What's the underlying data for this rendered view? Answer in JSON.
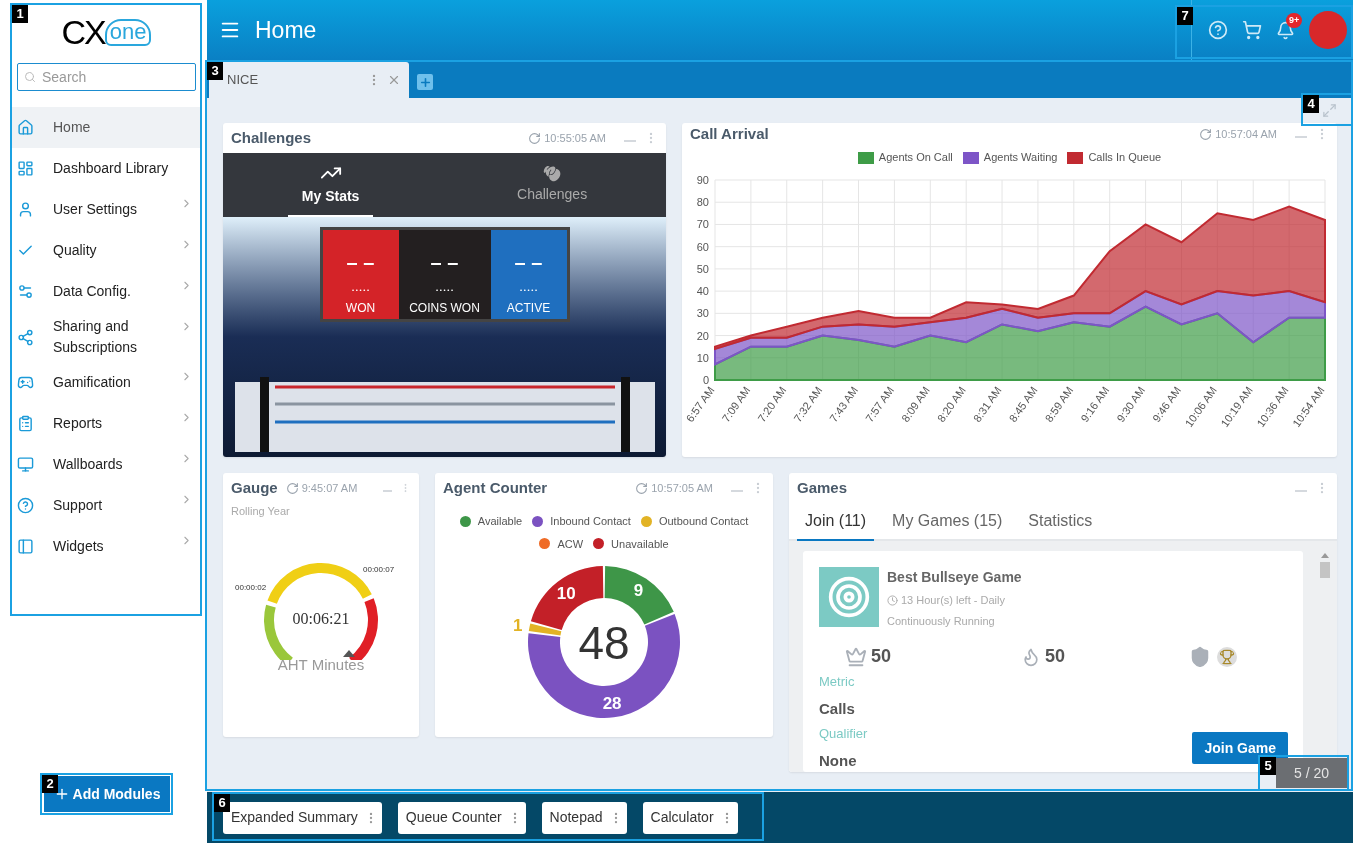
{
  "callouts": [
    "1",
    "2",
    "3",
    "4",
    "5",
    "6",
    "7"
  ],
  "sidebar": {
    "logo": {
      "main": "CX",
      "sub": "one"
    },
    "search": {
      "placeholder": "Search"
    },
    "items": [
      {
        "label": "Home",
        "selected": true,
        "expandable": false
      },
      {
        "label": "Dashboard Library",
        "selected": false,
        "expandable": false
      },
      {
        "label": "User Settings",
        "selected": false,
        "expandable": true
      },
      {
        "label": "Quality",
        "selected": false,
        "expandable": true
      },
      {
        "label": "Data Config.",
        "selected": false,
        "expandable": true
      },
      {
        "label": "Sharing and Subscriptions",
        "selected": false,
        "expandable": true
      },
      {
        "label": "Gamification",
        "selected": false,
        "expandable": true
      },
      {
        "label": "Reports",
        "selected": false,
        "expandable": true
      },
      {
        "label": "Wallboards",
        "selected": false,
        "expandable": true
      },
      {
        "label": "Support",
        "selected": false,
        "expandable": true
      },
      {
        "label": "Widgets",
        "selected": false,
        "expandable": true
      }
    ],
    "add_button": "Add Modules"
  },
  "header": {
    "title": "Home",
    "notification_badge": "9+"
  },
  "tabs": [
    {
      "label": "NICE",
      "selected": true
    }
  ],
  "challenges": {
    "title": "Challenges",
    "time": "10:55:05 AM",
    "tabs": [
      {
        "label": "My Stats",
        "selected": true
      },
      {
        "label": "Challenges",
        "selected": false
      }
    ],
    "scoreboard": [
      {
        "value": "– –",
        "dots": "• • • • •",
        "label": "WON",
        "color": "#d42328"
      },
      {
        "value": "– –",
        "dots": "• • • • •",
        "label": "COINS WON",
        "color": "#231f20"
      },
      {
        "value": "– –",
        "dots": "• • • • •",
        "label": "ACTIVE",
        "color": "#1f6fbf"
      }
    ]
  },
  "call_arrival": {
    "title": "Call Arrival",
    "time": "10:57:04 AM",
    "chart_data": {
      "type": "area",
      "stacked": true,
      "grid": true,
      "legend": "top",
      "categories": [
        "6:57 AM",
        "7:09 AM",
        "7:20 AM",
        "7:32 AM",
        "7:43 AM",
        "7:57 AM",
        "8:09 AM",
        "8:20 AM",
        "8:31 AM",
        "8:45 AM",
        "8:59 AM",
        "9:16 AM",
        "9:30 AM",
        "9:46 AM",
        "10:06 AM",
        "10:19 AM",
        "10:36 AM",
        "10:54 AM"
      ],
      "ylim": [
        0,
        90
      ],
      "yticks": [
        0,
        10,
        20,
        30,
        40,
        50,
        60,
        70,
        80,
        90
      ],
      "series": [
        {
          "name": "Agents On Call",
          "color": "#3e9c47",
          "values": [
            7,
            15,
            15,
            20,
            18,
            15,
            20,
            17,
            25,
            22,
            26,
            24,
            33,
            25,
            30,
            17,
            28,
            28
          ]
        },
        {
          "name": "Agents Waiting",
          "color": "#7d55c7",
          "values": [
            7,
            4,
            4,
            4,
            7,
            9,
            6,
            11,
            7,
            6,
            4,
            6,
            7,
            9,
            10,
            21,
            12,
            7
          ]
        },
        {
          "name": "Calls In Queue",
          "color": "#c12a31",
          "values": [
            1,
            1,
            5,
            4,
            6,
            4,
            2,
            7,
            2,
            4,
            8,
            28,
            30,
            28,
            35,
            34,
            38,
            37
          ]
        }
      ]
    }
  },
  "gauge": {
    "title": "Gauge",
    "time": "9:45:07 AM",
    "subtitle": "Rolling Year",
    "low_label": "00:00:02",
    "high_label": "00:00:07",
    "value": "00:06:21",
    "caption": "AHT Minutes"
  },
  "agent_counter": {
    "title": "Agent Counter",
    "time": "10:57:05 AM",
    "total": "48",
    "chart_data": {
      "type": "donut",
      "data_labels": true,
      "values": [
        9,
        28,
        1,
        0,
        10
      ]
    },
    "legend": [
      {
        "label": "Available",
        "color": "#3e9648"
      },
      {
        "label": "Inbound Contact",
        "color": "#7b52c1"
      },
      {
        "label": "Outbound Contact",
        "color": "#e2b325"
      },
      {
        "label": "ACW",
        "color": "#ef6b26"
      },
      {
        "label": "Unavailable",
        "color": "#c32028"
      }
    ]
  },
  "games": {
    "title": "Games",
    "tabs": [
      {
        "label": "Join (11)",
        "selected": true
      },
      {
        "label": "My Games (15)",
        "selected": false
      },
      {
        "label": "Statistics",
        "selected": false
      }
    ],
    "game": {
      "name": "Best Bullseye Game",
      "time_left": "13 Hour(s) left - Daily",
      "status": "Continuously Running",
      "crowns": "50",
      "flames": "50",
      "metric_label": "Metric",
      "metric": "Calls",
      "qualifier_label": "Qualifier",
      "qualifier": "None",
      "button": "Join Game"
    }
  },
  "pager": "5 / 20",
  "tray": [
    "Expanded Summary",
    "Queue Counter",
    "Notepad",
    "Calculator"
  ]
}
